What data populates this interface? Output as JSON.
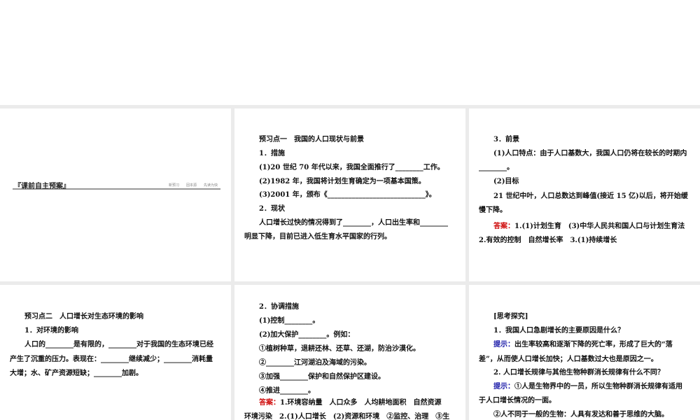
{
  "panel1": {
    "header_title": "『课前自主预案』",
    "tags": [
      "新预习",
      "固本源",
      "先读为快"
    ]
  },
  "panel2": {
    "lines": [
      "预习点一　我国的人口现状与前景",
      "1．措施",
      "(1)20 世纪 70 年代以来，我国全面推行了________工作。",
      "(2)1982 年，我国将计划生育确定为一项基本国策。",
      "(3)2001 年，颁布《____________________________》。",
      "2．现状",
      "人口增长过快的情况得到了________，人口出生率和________",
      "明显下降，目前已进入低生育水平国家的行列。"
    ]
  },
  "panel3": {
    "lines": [
      "3．前景",
      "(1)人口特点：由于人口基数大，我国人口仍将在较长的时期内",
      "________。",
      "(2)目标",
      "21 世纪中叶，人口总数达到峰值(接近 15 亿)以后，将开始缓",
      "慢下降。"
    ],
    "answer_label": "答案：",
    "answer_text": "1.(1)计划生育　(3)中华人民共和国人口与计划生育法",
    "answer_line2": "2.有效的控制　自然增长率　3.(1)持续增长"
  },
  "panel4": {
    "lines": [
      "预习点二　人口增长对生态环境的影响",
      "1．对环境的影响",
      "人口的________是有限的，________对于我国的生态环境已经",
      "产生了沉重的压力。表现在：________继续减少；________消耗量",
      "大增；水、矿产资源短缺；________加剧。"
    ]
  },
  "panel5": {
    "lines": [
      "2．协调措施",
      "(1)控制________。",
      "(2)加大保护________。例如：",
      "①植树种草，退耕还林、还草、还湖，防治沙漠化。",
      "②________江河湖泊及海域的污染。",
      "③加强________保护和自然保护区建设。",
      "④推进________。"
    ],
    "answer_label": "答案：",
    "answer_text": "1.环境容纳量　人口众多　人均耕地面积　自然资源",
    "answer_line2": "环境污染　2.(1)人口增长　(2)资源和环境　②监控、治理　③生"
  },
  "panel6": {
    "title": "[思考探究]",
    "q1": "1．我国人口急剧增长的主要原因是什么？",
    "hint_label": "提示：",
    "a1_1": "出生率较高和逐渐下降的死亡率，形成了巨大的“落",
    "a1_2": "差”，从而使人口增长加快；人口基数过大也是原因之一。",
    "q2": "2. 人口增长规律与其他生物种群消长规律有什么不同？",
    "a2_1": "①人是生物界中的一员，所以生物种群消长规律有适用",
    "a2_2": "于人口增长情况的一面。",
    "a2_3": "②人不同于一般的生物：人具有发达和善于思维的大脑。"
  }
}
